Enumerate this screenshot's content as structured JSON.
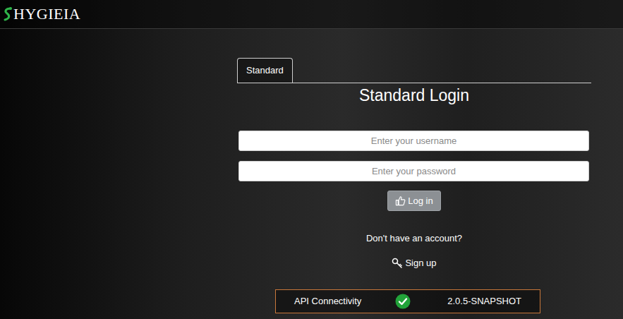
{
  "header": {
    "logo": "HYGIEIA"
  },
  "tabs": [
    {
      "label": "Standard",
      "selected": true
    }
  ],
  "login": {
    "title": "Standard Login",
    "username": {
      "placeholder": "Enter your username"
    },
    "password": {
      "placeholder": "Enter your password"
    },
    "button": "Log in",
    "prompt": "Don't have an account?",
    "signup": "Sign up"
  },
  "status": {
    "label": "API Connectivity",
    "ok": true,
    "version": "2.0.5-SNAPSHOT"
  }
}
